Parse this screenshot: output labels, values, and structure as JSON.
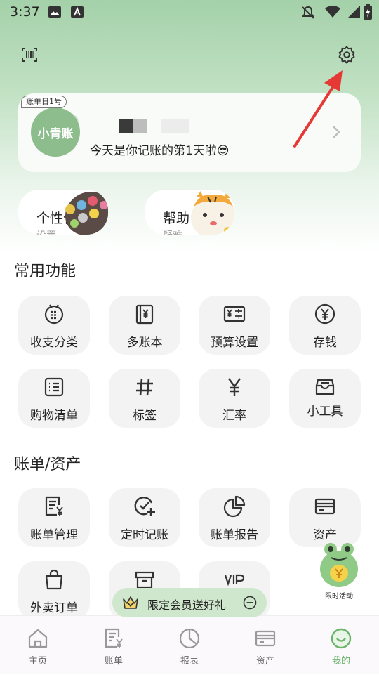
{
  "status_bar": {
    "time": "3:37"
  },
  "profile": {
    "tag": "账单日1号",
    "avatar_text": "小青账",
    "greeting": "今天是你记账的第1天啦😎"
  },
  "quick_cards": [
    {
      "title": "个性化",
      "sub": "设置"
    },
    {
      "title": "帮助",
      "sub": "疑难"
    }
  ],
  "sections": {
    "common": "常用功能",
    "bills": "账单/资产"
  },
  "common_functions": [
    {
      "label": "收支分类",
      "icon": "category-icon"
    },
    {
      "label": "多账本",
      "icon": "ledger-book-icon"
    },
    {
      "label": "预算设置",
      "icon": "budget-icon"
    },
    {
      "label": "存钱",
      "icon": "savings-icon"
    },
    {
      "label": "购物清单",
      "icon": "shopping-list-icon"
    },
    {
      "label": "标签",
      "icon": "tag-icon"
    },
    {
      "label": "汇率",
      "icon": "exchange-rate-icon"
    },
    {
      "label": "小工具",
      "icon": "toolbox-icon"
    }
  ],
  "bill_functions": [
    {
      "label": "账单管理",
      "icon": "bill-management-icon"
    },
    {
      "label": "定时记账",
      "icon": "scheduled-bookkeeping-icon"
    },
    {
      "label": "账单报告",
      "icon": "bill-report-icon"
    },
    {
      "label": "资产",
      "icon": "assets-icon"
    },
    {
      "label": "外卖订单",
      "icon": "takeout-order-icon"
    }
  ],
  "floating_activity": {
    "label": "限时活动"
  },
  "promo": {
    "text": "限定会员送好礼"
  },
  "bottom_nav": [
    {
      "label": "主页",
      "icon": "home-icon"
    },
    {
      "label": "账单",
      "icon": "bill-icon"
    },
    {
      "label": "报表",
      "icon": "report-icon"
    },
    {
      "label": "资产",
      "icon": "assets-icon"
    },
    {
      "label": "我的",
      "icon": "profile-icon",
      "active": true
    }
  ],
  "colors": {
    "accent": "#6bb36b",
    "header_green": "#a4d1a9",
    "arrow_red": "#e53935"
  }
}
